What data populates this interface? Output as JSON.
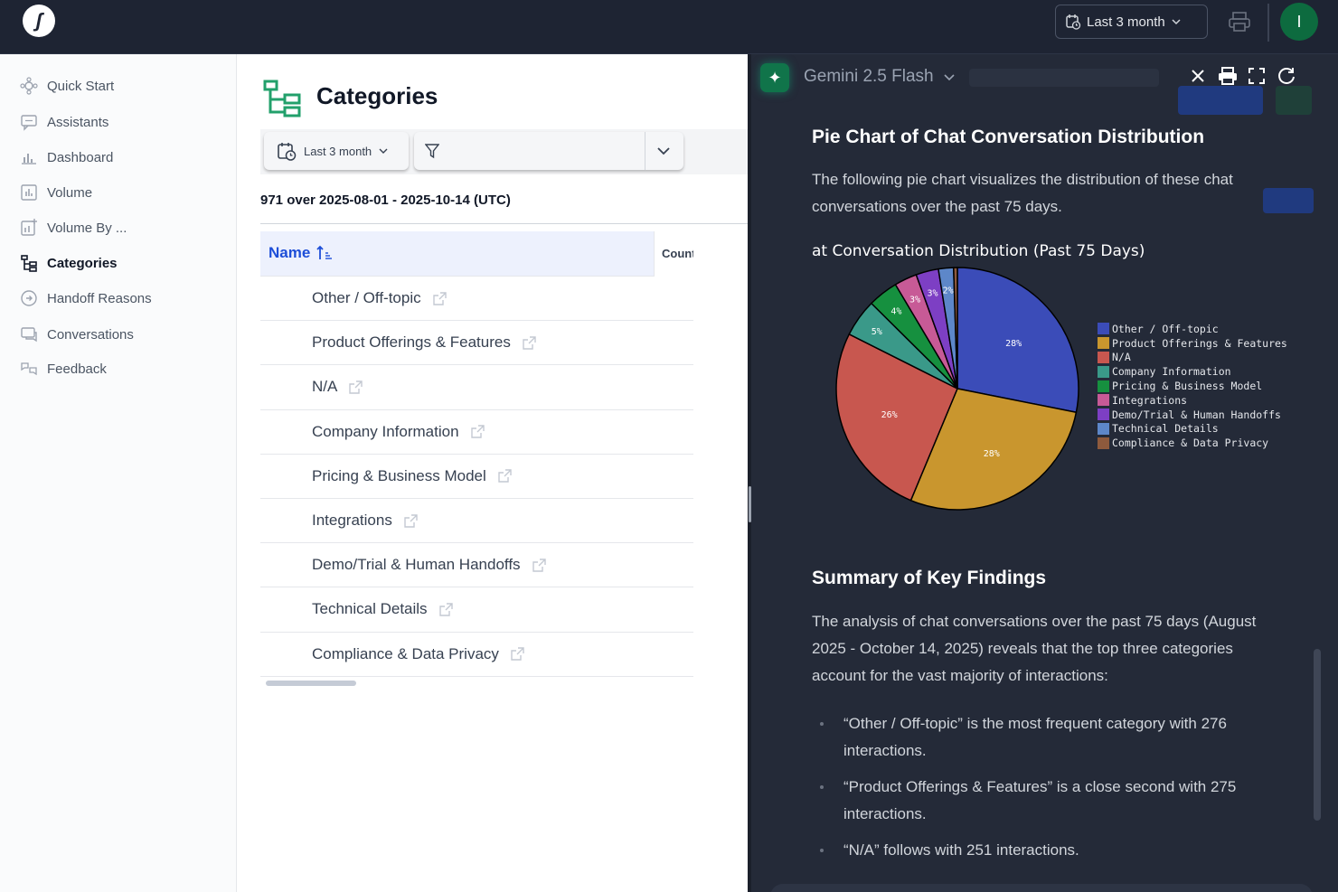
{
  "topbar": {
    "logo_glyph": "ʃ",
    "date_range_label": "Last 3 month",
    "avatar_initial": "I",
    "avatar_color": "#0d6b3f"
  },
  "sidebar": {
    "items": [
      {
        "label": "Quick Start",
        "icon": "quick-start-icon"
      },
      {
        "label": "Assistants",
        "icon": "chat-bubble-icon"
      },
      {
        "label": "Dashboard",
        "icon": "chart-icon"
      },
      {
        "label": "Volume",
        "icon": "bar-chart-icon"
      },
      {
        "label": "Volume By ...",
        "icon": "chart-plus-icon"
      },
      {
        "label": "Categories",
        "icon": "categories-icon",
        "active": true
      },
      {
        "label": "Handoff Reasons",
        "icon": "handoff-icon"
      },
      {
        "label": "Conversations",
        "icon": "conversations-icon"
      },
      {
        "label": "Feedback",
        "icon": "feedback-icon"
      }
    ]
  },
  "main": {
    "title": "Categories",
    "date_filter_label": "Last 3 month",
    "summary": "971 over 2025-08-01 - 2025-10-14 (UTC)",
    "table": {
      "col_name": "Name",
      "col_count": "Count",
      "rows": [
        "Other / Off-topic",
        "Product Offerings & Features",
        "N/A",
        "Company Information",
        "Pricing & Business Model",
        "Integrations",
        "Demo/Trial & Human Handoffs",
        "Technical Details",
        "Compliance & Data Privacy"
      ]
    }
  },
  "panel": {
    "model_name": "Gemini 2.5 Flash",
    "section1_title": "Pie Chart of Chat Conversation Distribution",
    "section1_text": "The following pie chart visualizes the distribution of these chat conversations over the past 75 days.",
    "section2_title": "Summary of Key Findings",
    "section2_text": "The analysis of chat conversations over the past 75 days (August 2025 - October 14, 2025) reveals that the top three categories account for the vast majority of interactions:",
    "bullets": [
      "“Other / Off-topic” is the most frequent category with 276 interactions.",
      "“Product Offerings & Features” is a close second with 275 interactions.",
      "“N/A” follows with 251 interactions."
    ]
  },
  "chart_data": {
    "type": "pie",
    "title": "at Conversation Distribution (Past 75 Days)",
    "categories": [
      "Other / Off-topic",
      "Product Offerings & Features",
      "N/A",
      "Company Information",
      "Pricing & Business Model",
      "Integrations",
      "Demo/Trial & Human Handoffs",
      "Technical Details",
      "Compliance & Data Privacy"
    ],
    "values": [
      28,
      28,
      26,
      5,
      4,
      3,
      3,
      2,
      0.5
    ],
    "labels": [
      "28%",
      "28%",
      "26%",
      "5%",
      "4%",
      "3%",
      "3%",
      "2%",
      ""
    ],
    "colors": [
      "#3b4cb8",
      "#c9962e",
      "#c8574f",
      "#3a9989",
      "#16903f",
      "#c75a96",
      "#7d3fc4",
      "#5d87c9",
      "#8e5a3d"
    ],
    "legend_placement": "right"
  }
}
